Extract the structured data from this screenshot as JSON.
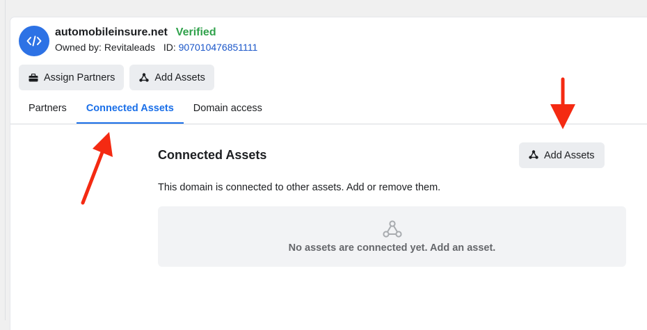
{
  "domain": {
    "name": "automobileinsure.net",
    "status": "Verified",
    "owner_text": "Owned by: Revitaleads",
    "id_label": "ID:",
    "id_value": "907010476851111"
  },
  "actions": {
    "assign_partners": "Assign Partners",
    "add_assets": "Add Assets"
  },
  "tabs": [
    {
      "label": "Partners",
      "active": false
    },
    {
      "label": "Connected Assets",
      "active": true
    },
    {
      "label": "Domain access",
      "active": false
    }
  ],
  "connected_assets": {
    "title": "Connected Assets",
    "add_button": "Add Assets",
    "description": "This domain is connected to other assets. Add or remove them.",
    "empty_message": "No assets are connected yet. Add an asset."
  },
  "colors": {
    "accent": "#1a6fe8",
    "verified": "#31a24c",
    "annotation_arrow": "#f42a12"
  },
  "icons": {
    "domain": "code-icon",
    "assign_partners": "briefcase-icon",
    "add_assets": "asset-network-icon",
    "empty_state": "asset-network-icon"
  }
}
